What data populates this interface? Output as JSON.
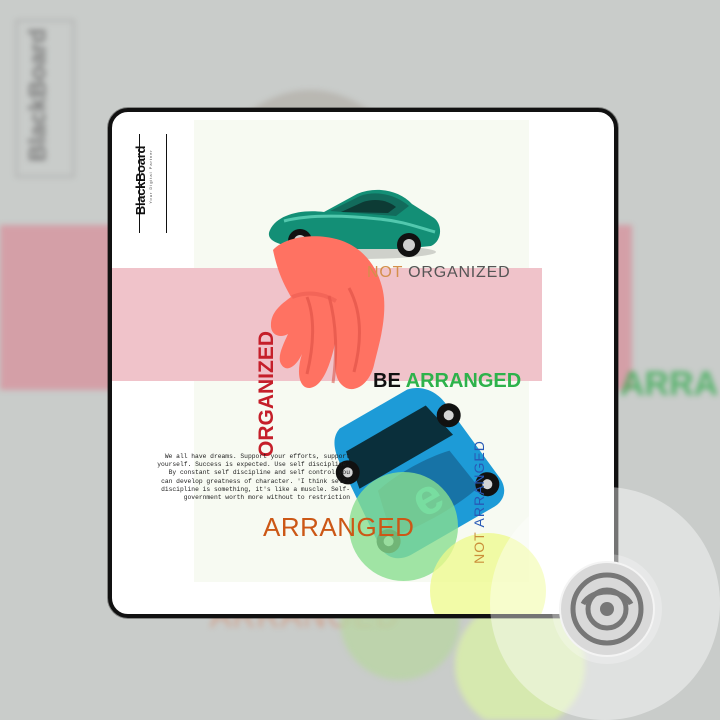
{
  "brand": {
    "logo": "BlackBoard",
    "tagline": "Your Digital Partner"
  },
  "poster": {
    "headline_not_organized": {
      "not": "NOT",
      "rest": "ORGANIZED"
    },
    "organized": "ORGANIZED",
    "be_arranged": {
      "be": "BE",
      "arranged": "ARRANGED"
    },
    "arranged": "ARRANGED",
    "not_arranged": {
      "not": "NOT",
      "arranged": "ARRANGED"
    },
    "paragraph": "We all have dreams. Support your efforts, support yourself. Success is expected. Use self discipline. By constant self discipline and self control you can develop greatness of character. 'I think self-discipline is something, it's like a muscle. Self-government worth more without to restriction"
  },
  "colors": {
    "accent_red": "#c51f2a",
    "accent_green": "#2db24b",
    "accent_orange": "#cc5716",
    "accent_blue": "#2859b6",
    "pink_band": "#f0c3ca"
  },
  "icons": {
    "steering_wheel": "steering-wheel-icon"
  }
}
